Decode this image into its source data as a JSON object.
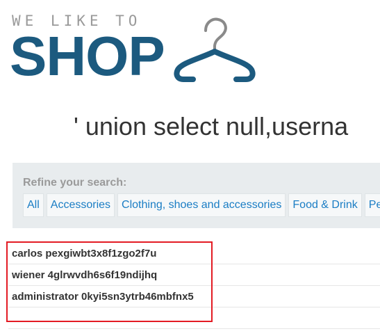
{
  "logo": {
    "tagline": "WE LIKE TO",
    "wordmark": "SHOP",
    "hanger_icon": "coat-hanger-icon",
    "colors": {
      "tagline": "#9a9a9a",
      "wordmark": "#1c5a7f",
      "hanger_hook": "#8a8a8a"
    }
  },
  "search_heading": "' union select null,userna",
  "filters": {
    "title": "Refine your search:",
    "categories": [
      "All",
      "Accessories",
      "Clothing, shoes and accessories",
      "Food & Drink",
      "Pe"
    ],
    "link_color": "#1a7dc4",
    "panel_color": "#e8ecee"
  },
  "results": [
    "carlos pexgiwbt3x8f1zgo2f7u",
    "wiener 4glrwvdh6s6f19ndijhq",
    "administrator 0kyi5sn3ytrb46mbfnx5"
  ],
  "annotation": {
    "highlight_color": "#e31b23"
  }
}
